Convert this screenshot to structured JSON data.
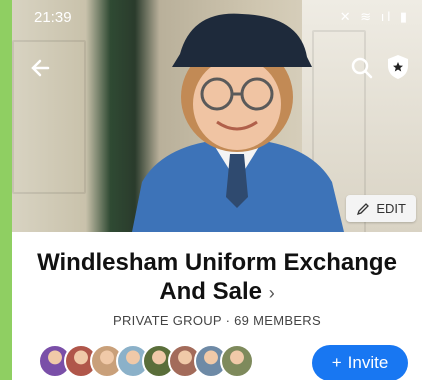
{
  "status_bar": {
    "time": "21:39",
    "icons_left": "◎ ☁ ℗ •",
    "icons_right": "✕ ≋ ıl ▮"
  },
  "header": {
    "back_icon": "arrow-left-icon",
    "search_icon": "search-icon",
    "admin_icon": "shield-star-icon"
  },
  "cover": {
    "edit_label": "EDIT"
  },
  "group": {
    "name": "Windlesham Uniform Exchange And Sale",
    "chevron": "›",
    "privacy": "PRIVATE GROUP",
    "separator": "·",
    "members": "69 MEMBERS"
  },
  "members_preview": {
    "avatar_colors": [
      "#7a4fa8",
      "#b0564a",
      "#c9a07a",
      "#8bb1c9",
      "#5a6e3a",
      "#a36b5a",
      "#6e8aa6",
      "#7e8a5c"
    ]
  },
  "actions": {
    "invite_label": "Invite",
    "invite_icon": "+"
  },
  "colors": {
    "accent": "#1877f2",
    "background": "#8fcf62"
  }
}
